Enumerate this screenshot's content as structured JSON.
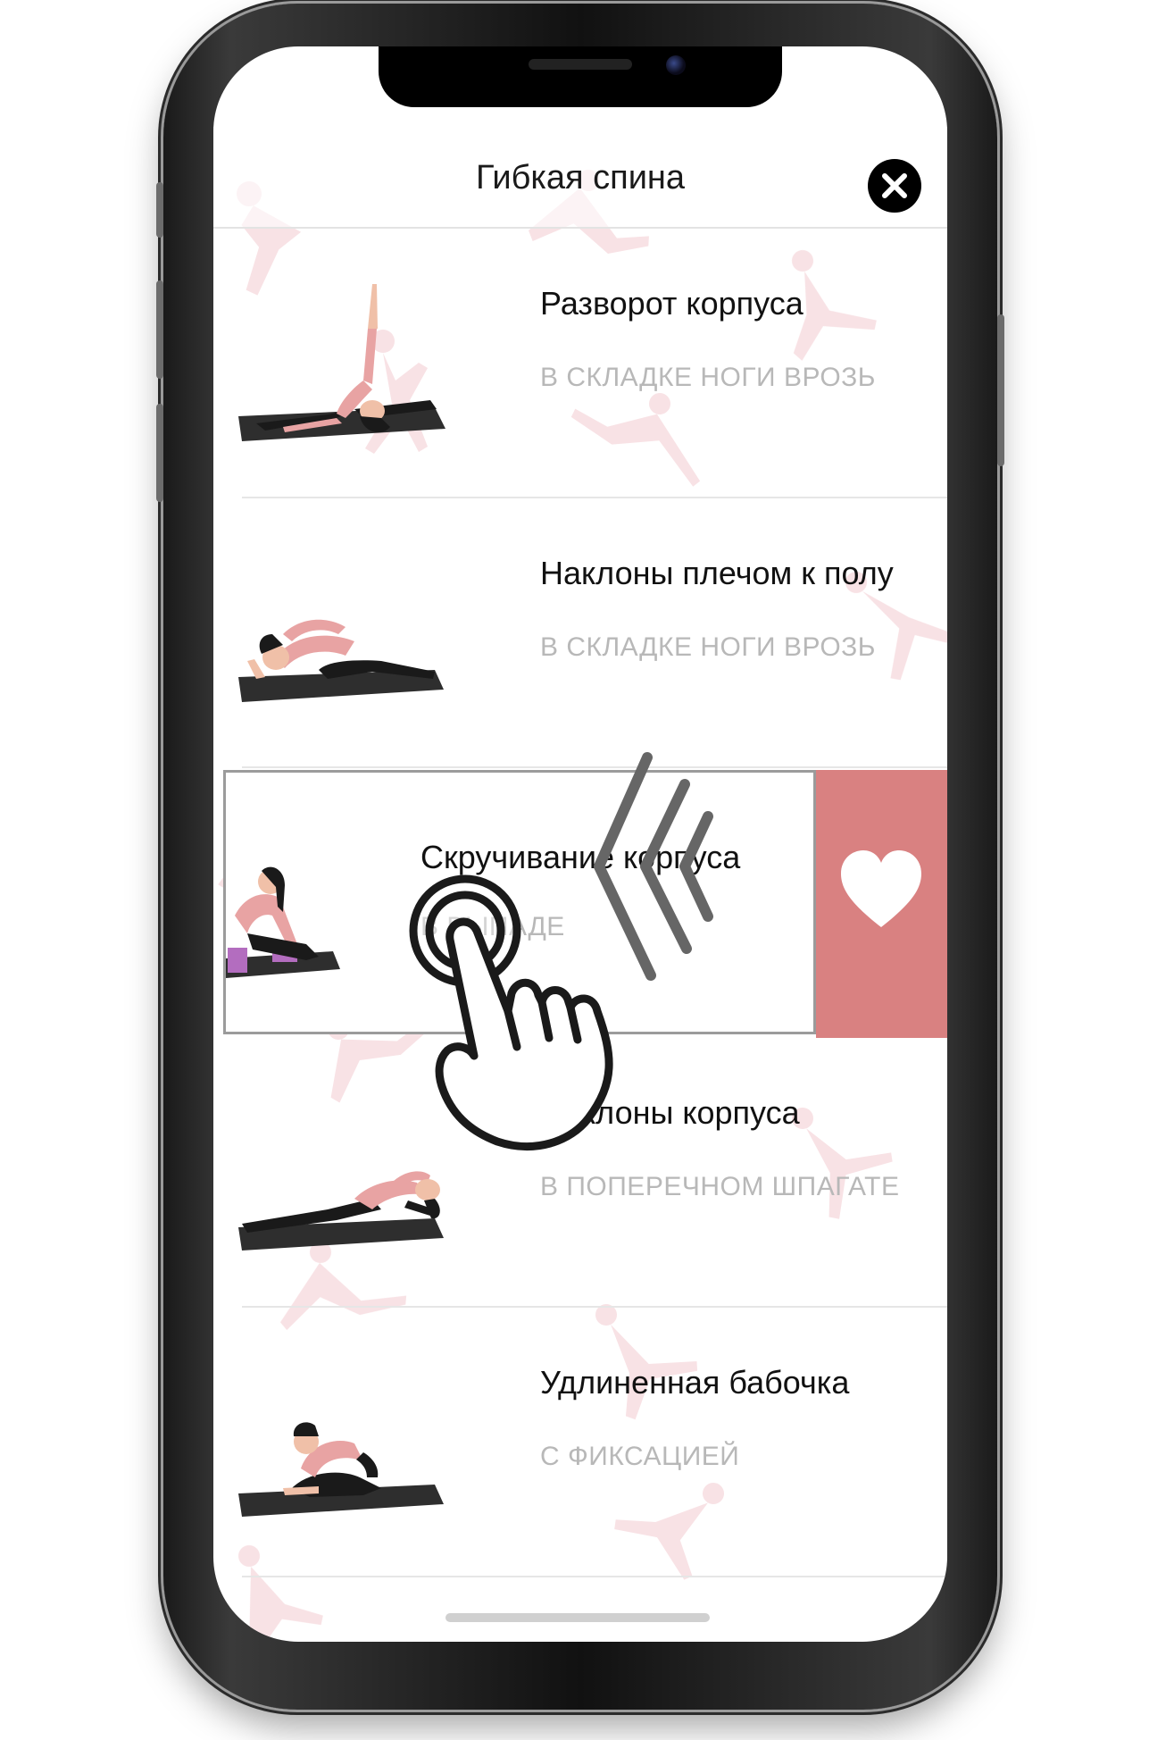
{
  "header": {
    "title": "Гибкая спина",
    "close_icon": "close-icon"
  },
  "exercises": [
    {
      "title": "Разворот корпуса",
      "subtitle": "В СКЛАДКЕ НОГИ ВРОЗЬ"
    },
    {
      "title": "Наклоны плечом к полу",
      "subtitle": "В СКЛАДКЕ НОГИ ВРОЗЬ"
    },
    {
      "title": "Скручивание корпуса",
      "subtitle": "В ВЫПАДЕ"
    },
    {
      "title": "Наклоны корпуса",
      "subtitle": "В ПОПЕРЕЧНОМ ШПАГАТЕ"
    },
    {
      "title": "Удлиненная бабочка",
      "subtitle": "С ФИКСАЦИЕЙ"
    }
  ],
  "swipe_action": {
    "icon": "heart-icon",
    "color": "#d98181"
  },
  "gesture": {
    "icon": "tap-swipe-hand-icon"
  },
  "colors": {
    "accent": "#d98181",
    "pattern": "#f6d8dc",
    "outfit": "#e8a3a3"
  }
}
